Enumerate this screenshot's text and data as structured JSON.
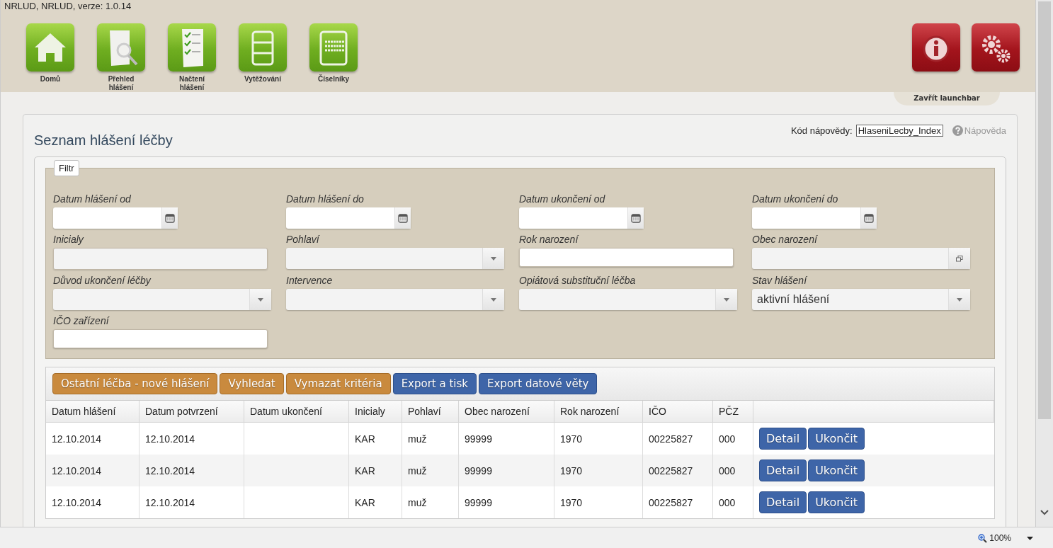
{
  "app_title": "NRLUD, NRLUD, verze: 1.0.14",
  "launchbar": {
    "items": [
      {
        "label": "Domů",
        "kind": "home"
      },
      {
        "label": "Přehled hlášení",
        "kind": "search-doc"
      },
      {
        "label": "Načtení hlášení",
        "kind": "list-doc"
      },
      {
        "label": "Vytěžování",
        "kind": "stack"
      },
      {
        "label": "Číselníky",
        "kind": "codes"
      }
    ],
    "right_items": [
      {
        "kind": "info"
      },
      {
        "kind": "gears"
      }
    ],
    "close_label": "Zavřít launchbar"
  },
  "page": {
    "title": "Seznam hlášení léčby",
    "help_code_label": "Kód nápovědy:",
    "help_code": "HlaseniLecby_Index",
    "help_link": "Nápověda"
  },
  "filter": {
    "legend": "Filtr",
    "fields": [
      {
        "label": "Datum hlášení od",
        "kind": "date",
        "disabled": false
      },
      {
        "label": "Datum hlášení do",
        "kind": "date",
        "disabled": false
      },
      {
        "label": "Datum ukončení od",
        "kind": "date",
        "disabled": false
      },
      {
        "label": "Datum ukončení do",
        "kind": "date",
        "disabled": false
      },
      {
        "label": "Inicialy",
        "kind": "text",
        "disabled": true
      },
      {
        "label": "Pohlaví",
        "kind": "select",
        "disabled": false
      },
      {
        "label": "Rok narození",
        "kind": "text",
        "disabled": false
      },
      {
        "label": "Obec narození",
        "kind": "lookup",
        "disabled": false
      },
      {
        "label": "Důvod ukončení léčby",
        "kind": "select",
        "disabled": false
      },
      {
        "label": "Intervence",
        "kind": "select",
        "disabled": false
      },
      {
        "label": "Opiátová substituční léčba",
        "kind": "select",
        "disabled": false
      },
      {
        "label": "Stav hlášení",
        "kind": "select",
        "disabled": false,
        "value": "aktivní hlášení"
      },
      {
        "label": "IČO zařízení",
        "kind": "text",
        "disabled": false
      }
    ]
  },
  "toolbar": [
    {
      "label": "Ostatní léčba - nové hlášení",
      "kind": "orange"
    },
    {
      "label": "Vyhledat",
      "kind": "orange"
    },
    {
      "label": "Vymazat kritéria",
      "kind": "orange"
    },
    {
      "label": "Export a tisk",
      "kind": "blue"
    },
    {
      "label": "Export datové věty",
      "kind": "blue"
    }
  ],
  "table": {
    "columns": [
      "Datum hlášení",
      "Datum potvrzení",
      "Datum ukončení",
      "Inicialy",
      "Pohlaví",
      "Obec narození",
      "Rok narození",
      "IČO",
      "PČZ"
    ],
    "rows": [
      {
        "cells": [
          "12.10.2014",
          "12.10.2014",
          "",
          "KAR",
          "muž",
          "99999",
          "1970",
          "00225827",
          "000"
        ],
        "actions": [
          "Detail",
          "Ukončit"
        ]
      },
      {
        "cells": [
          "12.10.2014",
          "12.10.2014",
          "",
          "KAR",
          "muž",
          "99999",
          "1970",
          "00225827",
          "000"
        ],
        "actions": [
          "Detail",
          "Ukončit"
        ]
      },
      {
        "cells": [
          "12.10.2014",
          "12.10.2014",
          "",
          "KAR",
          "muž",
          "99999",
          "1970",
          "00225827",
          "000"
        ],
        "actions": [
          "Detail",
          "Ukončit"
        ]
      }
    ]
  },
  "status_bar": {
    "zoom": "100%"
  }
}
